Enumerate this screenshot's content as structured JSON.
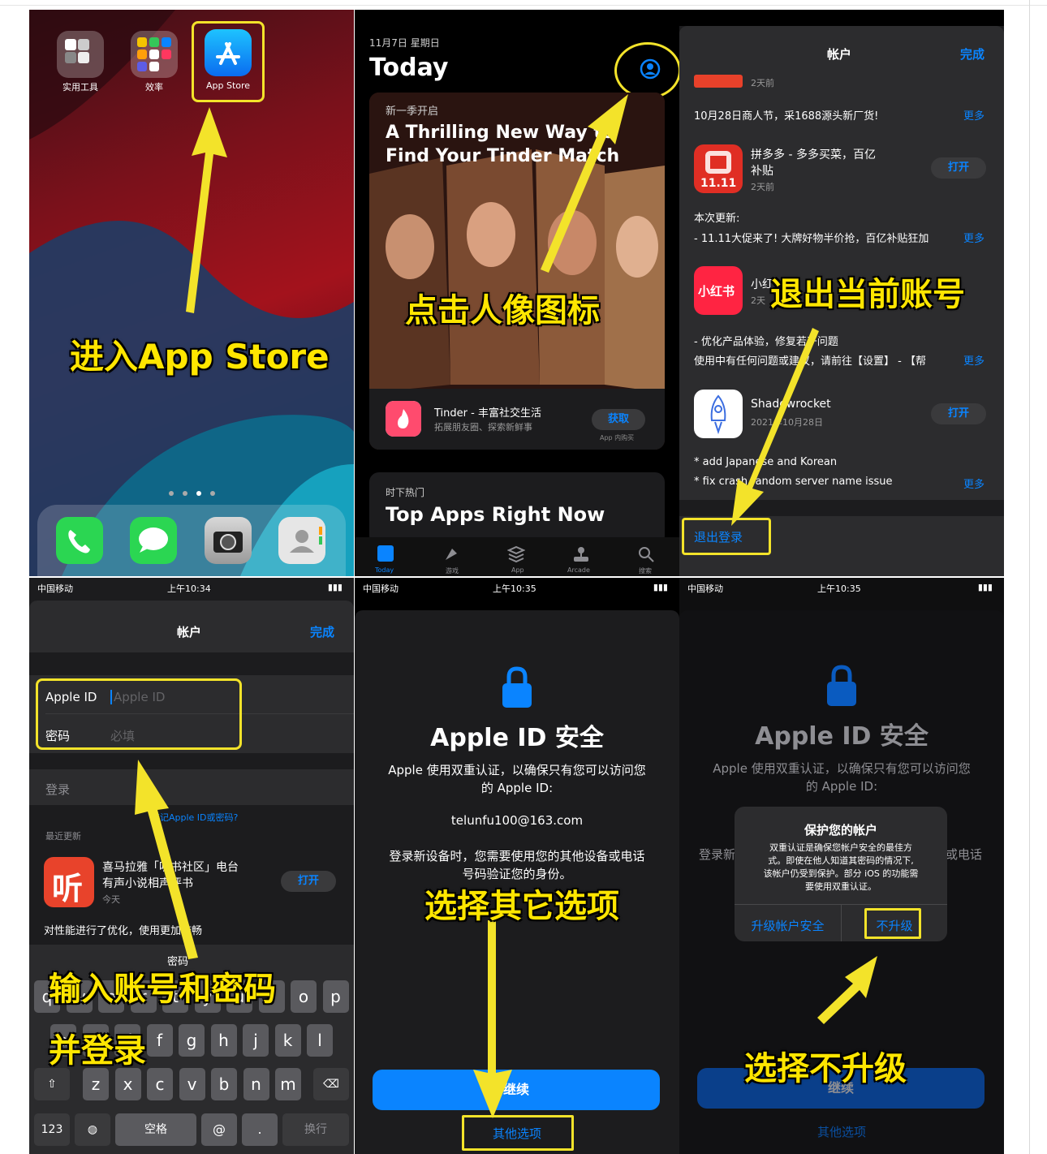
{
  "panel1": {
    "folder1_label": "实用工具",
    "folder2_label": "效率",
    "appstore_label": "App Store",
    "annotation": "进入App Store"
  },
  "panel2": {
    "date": "11月7日 星期日",
    "title": "Today",
    "card_kicker": "新一季开启",
    "card_title_line1": "A Thrilling New Way to",
    "card_title_line2": "Find Your Tinder Match",
    "app_name": "Tinder - 丰富社交生活",
    "app_sub": "拓展朋友圈、探索新鲜事",
    "get_label": "获取",
    "iap_label": "App 内购买",
    "section_kicker": "时下热门",
    "section_title": "Top Apps Right Now",
    "annotation": "点击人像图标",
    "tabs": [
      "Today",
      "游戏",
      "App",
      "Arcade",
      "搜索"
    ]
  },
  "panel3": {
    "header_title": "帐户",
    "done_label": "完成",
    "row0_meta": "2天前",
    "row0_note": "10月28日商人节，采1688源头新厂货!",
    "more_label": "更多",
    "pdd_name_line1": "拼多多 - 多多买菜，百亿",
    "pdd_name_line2": "补贴",
    "pdd_meta": "2天前",
    "pdd_icon_text": "11.11",
    "open_label": "打开",
    "update_heading": "本次更新:",
    "pdd_note": "- 11.11大促来了! 大牌好物半价抢，百亿补贴狂加",
    "xhs_icon_text": "小红书",
    "xhs_name": "小红",
    "xhs_meta": "2天",
    "xhs_note1": "- 优化产品体验，修复若干问题",
    "xhs_note2": "使用中有任何问题或建议，请前往【设置】 - 【帮",
    "shadow_name": "Shadowrocket",
    "shadow_meta": "2021年10月28日",
    "shadow_note1": "* add Japanese and Korean",
    "shadow_note2": "* fix crash random server name issue",
    "signout_label": "退出登录",
    "annotation": "退出当前账号"
  },
  "panel4": {
    "carrier": "中国移动",
    "time": "上午10:34",
    "header_title": "帐户",
    "done_label": "完成",
    "appleid_label": "Apple ID",
    "appleid_placeholder": "Apple ID",
    "password_label": "密码",
    "password_placeholder": "必填",
    "login_label": "登录",
    "forgot_label": "忘记Apple ID或密码?",
    "recent_label": "最近更新",
    "ting_icon_text": "听",
    "ting_name_line1": "喜马拉雅「听书社区」电台",
    "ting_name_line2": "有声小说相声评书",
    "ting_meta": "今天",
    "open_label": "打开",
    "ting_note": "对性能进行了优化，使用更加流畅",
    "kb_hint": "密码",
    "row1": [
      "q",
      "w",
      "e",
      "r",
      "t",
      "y",
      "u",
      "i",
      "o",
      "p"
    ],
    "row2": [
      "a",
      "s",
      "d",
      "f",
      "g",
      "h",
      "j",
      "k",
      "l"
    ],
    "row3": [
      "z",
      "x",
      "c",
      "v",
      "b",
      "n",
      "m"
    ],
    "key_123": "123",
    "key_space": "空格",
    "key_at": "@",
    "key_dot": ".",
    "key_return": "换行",
    "annotation_line1": "输入账号和密码",
    "annotation_line2": "并登录"
  },
  "panel5": {
    "carrier": "中国移动",
    "time": "上午10:35",
    "title": "Apple ID 安全",
    "desc_line1": "Apple 使用双重认证，以确保只有您可以访问您",
    "desc_line2": "的 Apple ID:",
    "email": "telunfu100@163.com",
    "note_line1": "登录新设备时，您需要使用您的其他设备或电话",
    "note_line2": "号码验证您的身份。",
    "continue_label": "继续",
    "other_label": "其他选项",
    "annotation": "选择其它选项"
  },
  "panel6": {
    "carrier": "中国移动",
    "time": "上午10:35",
    "title": "Apple ID 安全",
    "desc_line1": "Apple 使用双重认证，以确保只有您可以访问您",
    "desc_line2": "的 Apple ID:",
    "bg_left": "登录新",
    "bg_right": "或电话",
    "alert_title": "保护您的帐户",
    "alert_line1": "双重认证是确保您帐户安全的最佳方",
    "alert_line2": "式。即使在他人知道其密码的情况下,",
    "alert_line3": "该帐户仍受到保护。部分 iOS 的功能需",
    "alert_line4": "要使用双重认证。",
    "upgrade_label": "升级帐户安全",
    "noupgrade_label": "不升级",
    "continue_label": "继续",
    "other_label": "其他选项",
    "annotation": "选择不升级"
  }
}
